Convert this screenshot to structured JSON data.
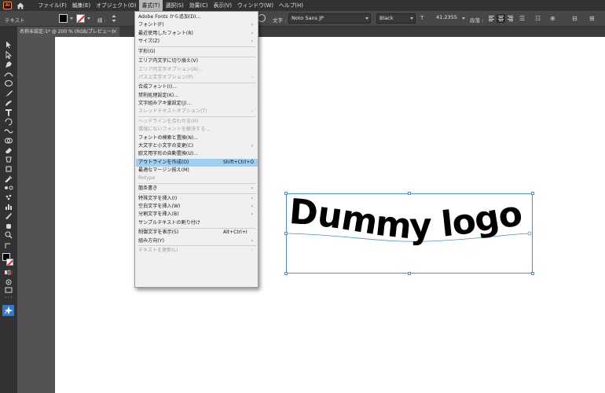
{
  "app": {
    "logo": "Ai"
  },
  "menubar": {
    "items": [
      {
        "label": "ファイル(F)",
        "active": false
      },
      {
        "label": "編集(E)",
        "active": false
      },
      {
        "label": "オブジェクト(O)",
        "active": false
      },
      {
        "label": "書式(T)",
        "active": true
      },
      {
        "label": "選択(S)",
        "active": false
      },
      {
        "label": "効果(C)",
        "active": false
      },
      {
        "label": "表示(V)",
        "active": false
      },
      {
        "label": "ウィンドウ(W)",
        "active": false
      },
      {
        "label": "ヘルプ(H)",
        "active": false
      }
    ]
  },
  "controlbar": {
    "label": "テキスト",
    "stroke_weight_label": "線 :",
    "character_label": "文字 :",
    "font_name": "Noto Sans JP",
    "font_style": "Black",
    "font_size": "41.2355",
    "paragraph_label": "段落 :"
  },
  "document": {
    "tab_title": "名称未設定-1* @ 200 % (RGB/プレビュー)",
    "tab_close": "×"
  },
  "toolbar": {
    "more": "···"
  },
  "artwork": {
    "logo_text": "Dummy logo"
  },
  "type_menu": {
    "sections": [
      [
        {
          "label": "Adobe Fonts から追加(D)...",
          "enabled": true,
          "submenu": false
        },
        {
          "label": "フォント(F)",
          "enabled": true,
          "submenu": true
        },
        {
          "label": "最近使用したフォント(R)",
          "enabled": true,
          "submenu": true
        },
        {
          "label": "サイズ(Z)",
          "enabled": true,
          "submenu": true
        }
      ],
      [
        {
          "label": "字形(G)",
          "enabled": true,
          "submenu": false
        }
      ],
      [
        {
          "label": "エリア内文字に切り換え(V)",
          "enabled": true,
          "submenu": false
        },
        {
          "label": "エリア内文字オプション(A)...",
          "enabled": false,
          "submenu": false
        },
        {
          "label": "パス上文字オプション(P)",
          "enabled": false,
          "submenu": true
        }
      ],
      [
        {
          "label": "合成フォント(I)...",
          "enabled": true,
          "submenu": false
        },
        {
          "label": "禁則処理設定(K)...",
          "enabled": true,
          "submenu": false
        },
        {
          "label": "文字組みアキ量設定(J)...",
          "enabled": true,
          "submenu": false
        },
        {
          "label": "スレッドテキストオプション(T)",
          "enabled": false,
          "submenu": true
        }
      ],
      [
        {
          "label": "ヘッドラインを合わせる(H)",
          "enabled": false,
          "submenu": false
        },
        {
          "label": "環境にないフォントを解決する...",
          "enabled": false,
          "submenu": false
        },
        {
          "label": "フォントの検索と置換(N)...",
          "enabled": true,
          "submenu": false
        },
        {
          "label": "大文字と小文字の変更(C)",
          "enabled": true,
          "submenu": true
        },
        {
          "label": "欧文用字形の自動置換(U)...",
          "enabled": true,
          "submenu": false
        },
        {
          "label": "アウトラインを作成(O)",
          "enabled": true,
          "submenu": false,
          "shortcut": "Shift+Ctrl+O",
          "highlight": true
        },
        {
          "label": "最適なマージン揃え(M)",
          "enabled": true,
          "submenu": false
        },
        {
          "label": "Retype",
          "enabled": false,
          "submenu": false
        }
      ],
      [
        {
          "label": "箇条書き",
          "enabled": true,
          "submenu": true
        }
      ],
      [
        {
          "label": "特殊文字を挿入(I)",
          "enabled": true,
          "submenu": true
        },
        {
          "label": "空白文字を挿入(W)",
          "enabled": true,
          "submenu": true
        },
        {
          "label": "分割文字を挿入(B)",
          "enabled": true,
          "submenu": true
        },
        {
          "label": "サンプルテキストの割り付け",
          "enabled": true,
          "submenu": false
        }
      ],
      [
        {
          "label": "制御文字を表示(S)",
          "enabled": true,
          "submenu": false,
          "shortcut": "Alt+Ctrl+I"
        },
        {
          "label": "組み方向(Y)",
          "enabled": true,
          "submenu": true
        }
      ],
      [
        {
          "label": "テキストを更新(L)",
          "enabled": false,
          "submenu": true
        }
      ]
    ]
  }
}
